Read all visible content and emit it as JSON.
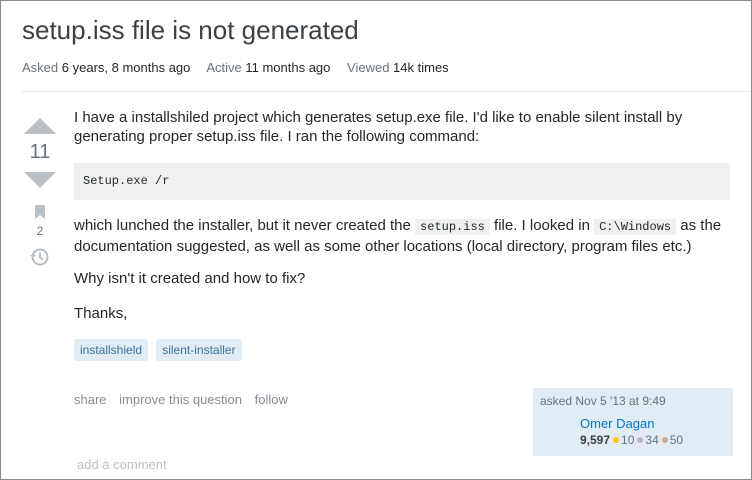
{
  "question": {
    "title": "setup.iss file is not generated",
    "meta": {
      "asked_label": "Asked",
      "asked_value": "6 years, 8 months ago",
      "active_label": "Active",
      "active_value": "11 months ago",
      "viewed_label": "Viewed",
      "viewed_value": "14k times"
    },
    "vote_count": "11",
    "favorite_count": "2",
    "body": {
      "p1": "I have a installshiled project which generates setup.exe file. I'd like to enable silent install by generating proper setup.iss file. I ran the following command:",
      "code": "Setup.exe /r",
      "p2_a": "which lunched the installer, but it never created the ",
      "p2_code1": "setup.iss",
      "p2_b": " file. I looked in ",
      "p2_code2": "C:\\Windows",
      "p2_c": " as the documentation suggested, as well as some other locations (local directory, program files etc.)",
      "p3": "Why isn't it created and how to fix?",
      "p4": "Thanks,"
    },
    "tags": [
      "installshield",
      "silent-installer"
    ],
    "actions": [
      "share",
      "improve this question",
      "follow"
    ],
    "owner": {
      "asked": "asked Nov 5 '13 at 9:49",
      "name": "Omer Dagan",
      "reputation": "9,597",
      "gold": "10",
      "silver": "34",
      "bronze": "50"
    },
    "add_comment": "add a comment"
  },
  "colors": {
    "tag_bg": "#e1ecf4",
    "tag_text": "#39739d",
    "link": "#0077cc",
    "muted": "#6a737c",
    "gold": "#ffcc01",
    "silver": "#b4b8bc",
    "bronze": "#d1a684"
  },
  "icons": [
    "upvote-icon",
    "downvote-icon",
    "bookmark-icon",
    "history-icon"
  ]
}
